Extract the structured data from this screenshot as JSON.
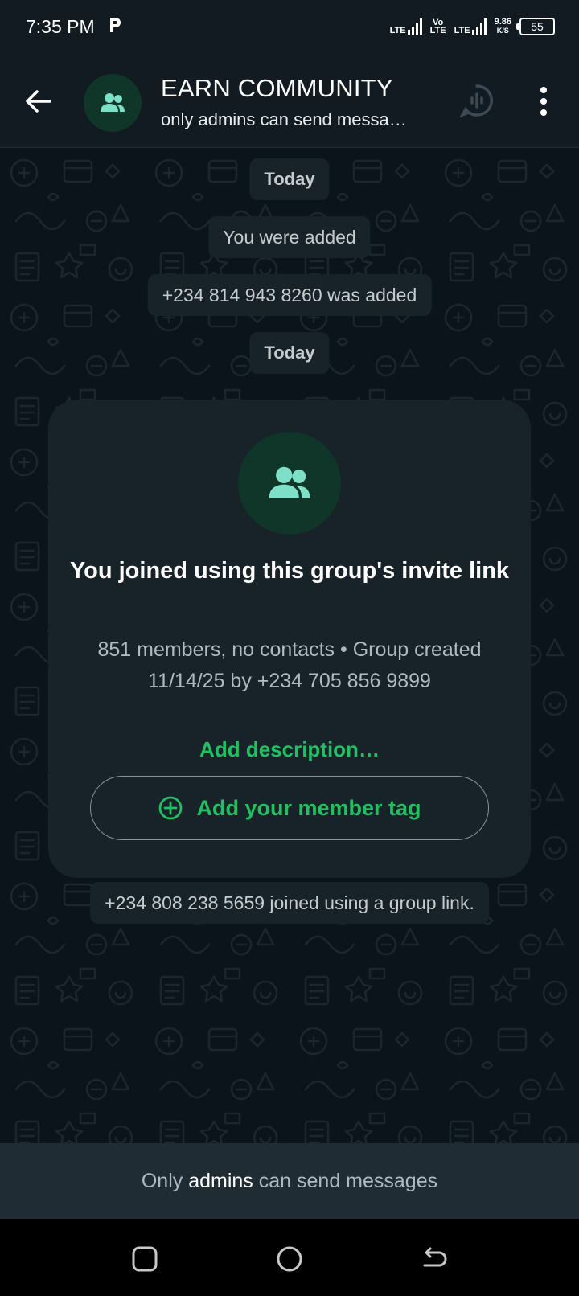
{
  "status_bar": {
    "time": "7:35 PM",
    "app_icon": "p-icon",
    "lte1": "LTE",
    "volte_top": "Vo",
    "volte_bottom": "LTE",
    "lte2": "LTE",
    "speed_value": "9.86",
    "speed_unit": "K/S",
    "battery": "55"
  },
  "header": {
    "back_icon": "arrow-left-icon",
    "avatar_icon": "group-icon",
    "title": "EARN COMMUNITY",
    "subtitle": "only admins can send messa…",
    "voice_chat_icon": "voice-chat-icon",
    "menu_icon": "more-vert-icon"
  },
  "messages": {
    "date1": "Today",
    "sys1": "You were added",
    "sys2": "+234 814 943 8260 was added",
    "date2": "Today",
    "sys3": "+234 808 238 5659 joined using a group link."
  },
  "card": {
    "icon": "group-icon",
    "title": "You joined using this group's invite link",
    "meta": "851 members, no contacts • Group created 11/14/25 by +234 705 856 9899",
    "add_description": "Add description…",
    "member_tag_icon": "plus-circle-icon",
    "member_tag_label": "Add your member tag"
  },
  "footer": {
    "prefix": "Only",
    "highlight": "admins",
    "suffix": "can send messages"
  },
  "nav": {
    "recents_icon": "square-icon",
    "home_icon": "circle-icon",
    "back_icon": "back-arrow-icon"
  },
  "colors": {
    "accent": "#21c063",
    "background": "#0b141a",
    "header": "#121b22",
    "bubble": "#182229"
  }
}
